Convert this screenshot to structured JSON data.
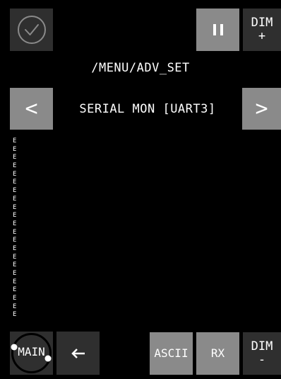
{
  "header": {
    "dim_plus_label": "DIM",
    "dim_plus_sign": "+",
    "pause_icon": "pause-icon",
    "confirm_icon": "check-circle-icon"
  },
  "path": "/MENU/ADV_SET",
  "nav": {
    "title": "SERIAL MON [UART3]",
    "prev_label": "<",
    "next_label": ">"
  },
  "log_lines": [
    "E",
    "E",
    "E",
    "E",
    "E",
    "E",
    "E",
    "E",
    "E",
    "E",
    "E",
    "E",
    "E",
    "E",
    "E",
    "E",
    "E",
    "E",
    "E",
    "E",
    "E",
    "E"
  ],
  "footer": {
    "main_label": "MAIN",
    "back_icon": "arrow-left-icon",
    "ascii_label": "ASCII",
    "rx_label": "RX",
    "dim_minus_label": "DIM",
    "dim_minus_sign": "-"
  },
  "colors": {
    "background": "#000000",
    "button_dark": "#2f2f2f",
    "button_light": "#8a8a8a",
    "text": "#ffffff"
  }
}
